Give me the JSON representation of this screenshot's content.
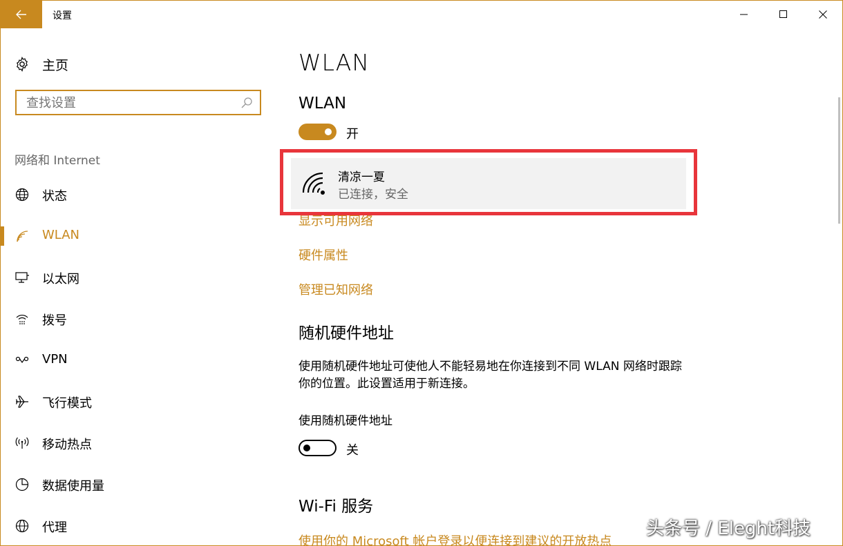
{
  "window": {
    "title": "设置"
  },
  "sidebar": {
    "home_label": "主页",
    "search_placeholder": "查找设置",
    "section_label": "网络和 Internet",
    "items": [
      {
        "label": "状态",
        "icon": "globe-status-icon"
      },
      {
        "label": "WLAN",
        "icon": "wifi-icon",
        "active": true
      },
      {
        "label": "以太网",
        "icon": "ethernet-icon"
      },
      {
        "label": "拨号",
        "icon": "dialup-icon"
      },
      {
        "label": "VPN",
        "icon": "vpn-icon"
      },
      {
        "label": "飞行模式",
        "icon": "airplane-icon"
      },
      {
        "label": "移动热点",
        "icon": "hotspot-icon"
      },
      {
        "label": "数据使用量",
        "icon": "data-usage-icon"
      },
      {
        "label": "代理",
        "icon": "proxy-icon"
      }
    ]
  },
  "main": {
    "page_title": "WLAN",
    "wlan_section_title": "WLAN",
    "wlan_toggle_label": "开",
    "network": {
      "name": "清凉一夏",
      "status": "已连接，安全"
    },
    "links": {
      "show_networks": "显示可用网络",
      "hardware_properties": "硬件属性",
      "manage_known": "管理已知网络"
    },
    "random_hw": {
      "title": "随机硬件地址",
      "description": "使用随机硬件地址可使他人不能轻易地在你连接到不同 WLAN 网络时跟踪你的位置。此设置适用于新连接。",
      "setting_label": "使用随机硬件地址",
      "toggle_label": "关"
    },
    "wifi_services": {
      "title": "Wi-Fi 服务",
      "link": "使用你的 Microsoft 帐户登录以便连接到建议的开放热点"
    }
  },
  "watermark": "头条号 / Eleght科技",
  "colors": {
    "accent": "#c8891f",
    "highlight": "#e8353b"
  }
}
